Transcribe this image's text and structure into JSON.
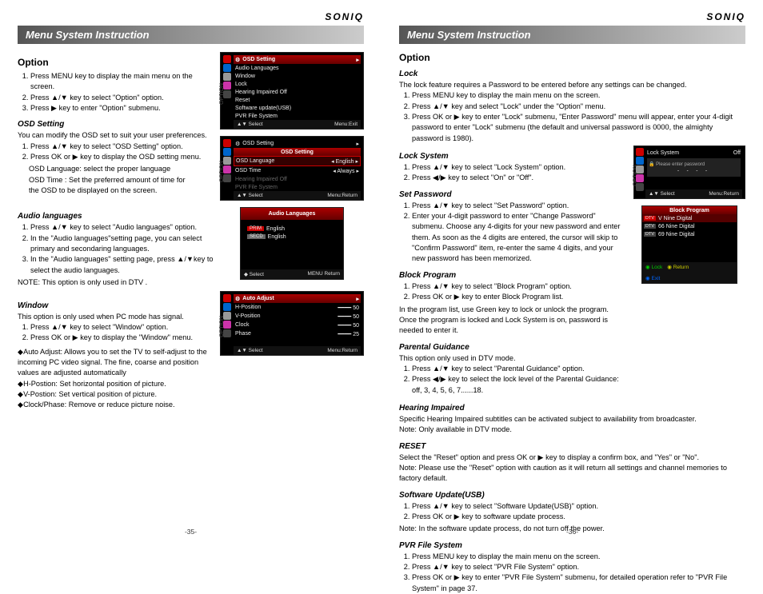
{
  "brand": "SONIQ",
  "banner": "Menu System Instruction",
  "p35": {
    "h": "Option",
    "intro": [
      "Press MENU key to display the main menu on the screen.",
      "Press ▲/▼ key to select \"Option\" option.",
      "Press ▶ key to enter \"Option\" submenu."
    ],
    "osdSetting": {
      "h": "OSD Setting",
      "p1": "You can modify the OSD set to suit your user preferences.",
      "l1": "Press ▲/▼ key to select \"OSD Setting\" option.",
      "l2": "Press OK or ▶ key to display the OSD setting menu.",
      "n1": "OSD Language: select the proper language",
      "n2": "OSD Time : Set the preferred amount of time for",
      "n3": "the OSD to be displayed on the screen."
    },
    "audio": {
      "h": "Audio languages",
      "l1": "Press ▲/▼ key to select \"Audio languages\" option.",
      "l2": "In the \"Audio languages\"setting page, you can select primary and secondaring languages.",
      "l3": "In the \"Audio languages\" setting page, press ▲/▼key to select the audio languages.",
      "note": "NOTE: This option is only used in DTV ."
    },
    "window": {
      "h": "Window",
      "p1": "This option is only used when PC mode has signal.",
      "l1": "Press ▲/▼ key to select \"Window\" option.",
      "l2": "Press OK or ▶ key to display the \"Window\" menu.",
      "b1": "◆Auto Adjust: Allows you to set the TV to self-adjust to the incoming PC video signal. The fine, coarse and position values are adjusted automatically",
      "b2": "◆H-Postion: Set horizontal position of picture.",
      "b3": "◆V-Postion: Set vertical position of picture.",
      "b4": "◆Clock/Phase: Remove or reduce picture noise."
    },
    "osd1": {
      "title": "OSD Setting",
      "items": [
        "Audio Languages",
        "Window",
        "Lock",
        "Hearing Impaired      Off",
        "Reset",
        "Software update(USB)",
        "PVR File System"
      ],
      "foot1": "▲▼  Select",
      "foot2": "Menu:Exit"
    },
    "osd2": {
      "title": "OSD Setting",
      "sub": "OSD Setting",
      "r1l": "OSD Language",
      "r1r": "◂  English  ▸",
      "r2l": "OSD Time",
      "r2r": "◂  Always  ▸",
      "r3": "Hearing Impaired      Off",
      "r4": "PVR File System",
      "foot1": "▲▼  Select",
      "foot2": "Menu:Return"
    },
    "osd3": {
      "title": "Audio Languages",
      "p": "English",
      "s": "English",
      "foot1": "◆  Select",
      "foot2": "MENU  Return"
    },
    "osd4": {
      "r0": "Auto Adjust",
      "r1": "H-Position",
      "v1": "50",
      "r2": "V-Position",
      "v2": "50",
      "r3": "Clock",
      "v3": "50",
      "r4": "Phase",
      "v4": "25",
      "foot1": "▲▼  Select",
      "foot2": "Menu:Return"
    },
    "num": "-35-"
  },
  "p36": {
    "h": "Option",
    "lock": {
      "h": "Lock",
      "p": "The lock feature requires a Password to be entered before any settings can be changed.",
      "l1": "Press MENU key to display the main menu on the screen.",
      "l2": "Press ▲/▼ key and select \"Lock\" under the \"Option\" menu.",
      "l3": "Press OK or ▶ key to enter \"Lock\" submenu, \"Enter Password\" menu will appear, enter your 4-digit password to enter \"Lock\" submenu (the default and universal password is 0000, the almighty password is 1980)."
    },
    "lockSys": {
      "h": "Lock System",
      "l1": "Press ▲/▼ key to select \"Lock System\" option.",
      "l2": "Press ◀/▶ key to select \"On\" or \"Off\"."
    },
    "setPw": {
      "h": "Set Password",
      "l1": "Press ▲/▼ key to select \"Set Password\" option.",
      "l2": "Enter your 4-digit password to enter \"Change Password\" submenu. Choose any 4-digits for your new password and enter them. As soon as the 4 digits are entered, the cursor will skip to \"Confirm Password\" item, re-enter the same 4 digits, and your new password has been memorized."
    },
    "block": {
      "h": "Block Program",
      "l1": "Press ▲/▼ key to select \"Block Program\" option.",
      "l2": "Press OK or ▶ key to enter Block Program list.",
      "p": "In the program list, use Green key to lock or unlock the program. Once the program is locked and Lock System is on, password is needed to enter it."
    },
    "parental": {
      "h": "Parental Guidance",
      "p": "This option only used in DTV mode.",
      "l1": "Press ▲/▼ key to select \"Parental Guidance\" option.",
      "l2": "Press ◀/▶ key to select the lock level of the Parental Guidance: off, 3, 4, 5, 6, 7......18."
    },
    "hi": {
      "h": "Hearing Impaired",
      "p": "Specific Hearing Impaired subtitles can be activated subject to availability from broadcaster.",
      "n": "Note: Only available in DTV mode."
    },
    "reset": {
      "h": "RESET",
      "p": "Select the \"Reset\" option and press OK or ▶ key to display a confirm box, and \"Yes\" or \"No\".",
      "n": "Note: Please use the \"Reset\" option with caution as it will return all settings and channel memories to factory default."
    },
    "sw": {
      "h": "Software Update(USB)",
      "l1": "Press ▲/▼ key to select \"Software Update(USB)\" option.",
      "l2": "Press OK or ▶ key to software update process.",
      "n": "Note: In the software update process, do not turn off the power."
    },
    "pvr": {
      "h": "PVR File System",
      "l1": "Press MENU key to display the main menu on the screen.",
      "l2": "Press ▲/▼ key to select \"PVR File System\" option.",
      "l3": "Press OK or ▶ key to enter \"PVR File System\" submenu, for detailed operation refer to \"PVR File System\" in page 37."
    },
    "osdLock": {
      "r1": "Lock System",
      "r1v": "Off",
      "p": "Please enter password",
      "foot1": "▲▼  Select",
      "foot2": "Menu:Return"
    },
    "osdBlock": {
      "title": "Block Program",
      "r1": "V Nine Digital",
      "r2": "66 Nine Digital",
      "r3": "69 Nine Digital",
      "fA": "◉  Lock",
      "fB": "◉  Return",
      "fC": "◉  Exit"
    },
    "num": "-36-"
  }
}
